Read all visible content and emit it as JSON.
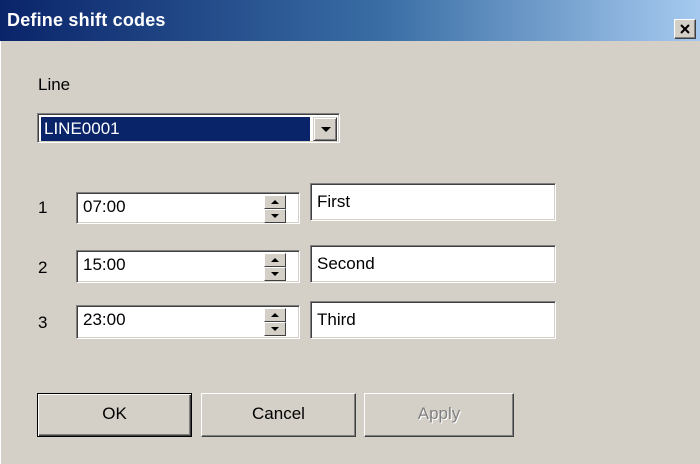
{
  "window": {
    "title": "Define shift codes",
    "close_glyph": "close-icon"
  },
  "line": {
    "label": "Line",
    "selected": "LINE0001"
  },
  "shifts": [
    {
      "number": "1",
      "time": "07:00",
      "name": "First"
    },
    {
      "number": "2",
      "time": "15:00",
      "name": "Second"
    },
    {
      "number": "3",
      "time": "23:00",
      "name": "Third"
    }
  ],
  "buttons": {
    "ok": "OK",
    "cancel": "Cancel",
    "apply": "Apply"
  },
  "colors": {
    "title_bar_start": "#0a246a",
    "title_bar_end": "#a6caf0",
    "dialog_face": "#d4d0c8",
    "selection": "#0a246a"
  }
}
